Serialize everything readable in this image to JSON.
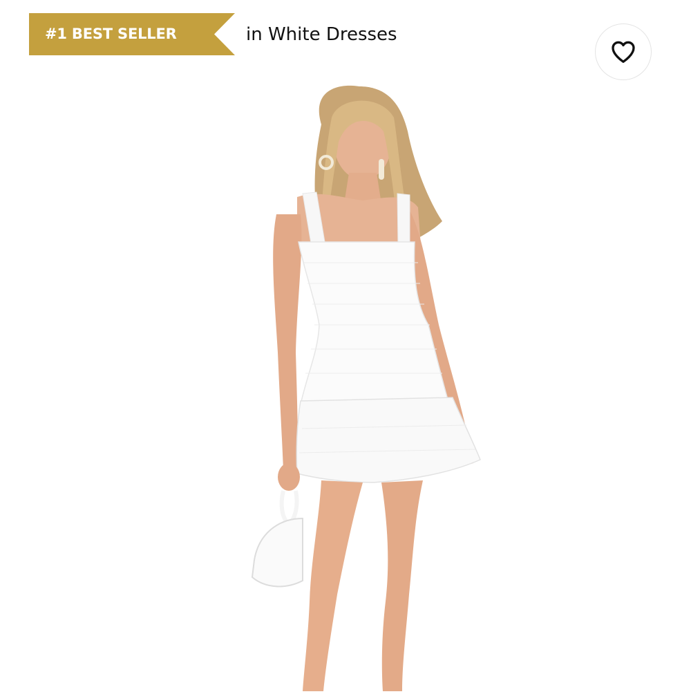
{
  "badge": {
    "label": "#1 BEST SELLER",
    "color": "#c4a03e"
  },
  "category": {
    "text": "in White Dresses"
  },
  "wishlist": {
    "icon": "heart-outline-icon"
  },
  "product": {
    "image": "model-in-white-mini-dress"
  }
}
